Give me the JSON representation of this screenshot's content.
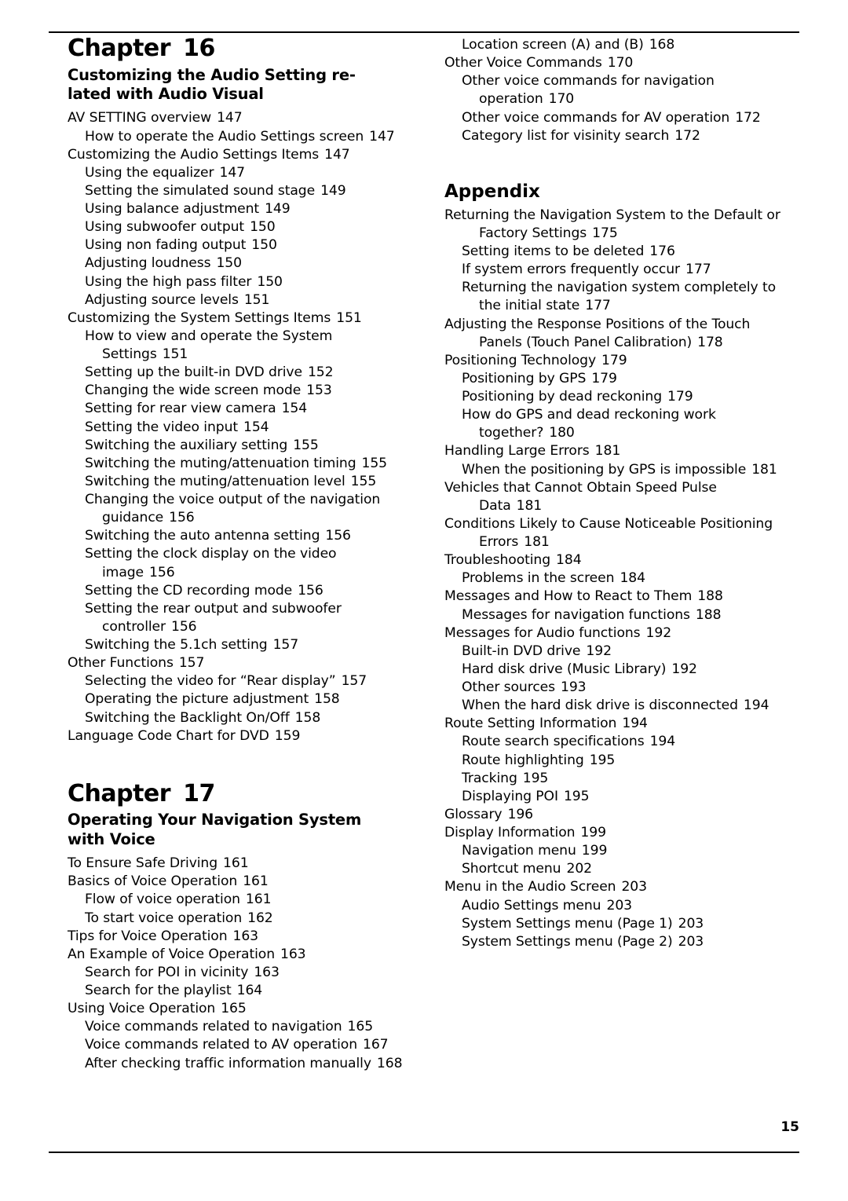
{
  "page_number": "15",
  "left_column": {
    "chapter": {
      "word": "Chapter",
      "number": "16"
    },
    "chapter_title_line1": "Customizing the Audio Setting re-",
    "chapter_title_line2": "lated with Audio Visual",
    "entries": [
      {
        "level": 0,
        "text": "AV SETTING overview",
        "page": "147"
      },
      {
        "level": 1,
        "text": "How to operate the Audio Settings screen",
        "page": "147"
      },
      {
        "level": 0,
        "text": "Customizing the Audio Settings Items",
        "page": "147"
      },
      {
        "level": 1,
        "text": "Using the equalizer",
        "page": "147"
      },
      {
        "level": 1,
        "text": "Setting the simulated sound stage",
        "page": "149"
      },
      {
        "level": 1,
        "text": "Using balance adjustment",
        "page": "149"
      },
      {
        "level": 1,
        "text": "Using subwoofer output",
        "page": "150"
      },
      {
        "level": 1,
        "text": "Using non fading output",
        "page": "150"
      },
      {
        "level": 1,
        "text": "Adjusting loudness",
        "page": "150"
      },
      {
        "level": 1,
        "text": "Using the high pass filter",
        "page": "150"
      },
      {
        "level": 1,
        "text": "Adjusting source levels",
        "page": "151"
      },
      {
        "level": 0,
        "text": "Customizing the System Settings Items",
        "page": "151"
      },
      {
        "level": 1,
        "text": "How to view and operate the System",
        "page": ""
      },
      {
        "level": 2,
        "text": "Settings",
        "page": "151"
      },
      {
        "level": 1,
        "text": "Setting up the built-in DVD drive",
        "page": "152"
      },
      {
        "level": 1,
        "text": "Changing the wide screen mode",
        "page": "153"
      },
      {
        "level": 1,
        "text": "Setting for rear view camera",
        "page": "154"
      },
      {
        "level": 1,
        "text": "Setting the video input",
        "page": "154"
      },
      {
        "level": 1,
        "text": "Switching the auxiliary setting",
        "page": "155"
      },
      {
        "level": 1,
        "text": "Switching the muting/attenuation timing",
        "page": "155"
      },
      {
        "level": 1,
        "text": "Switching the muting/attenuation level",
        "page": "155"
      },
      {
        "level": 1,
        "text": "Changing the voice output of the navigation",
        "page": ""
      },
      {
        "level": 2,
        "text": "guidance",
        "page": "156"
      },
      {
        "level": 1,
        "text": "Switching the auto antenna setting",
        "page": "156"
      },
      {
        "level": 1,
        "text": "Setting the clock display on the video",
        "page": ""
      },
      {
        "level": 2,
        "text": "image",
        "page": "156"
      },
      {
        "level": 1,
        "text": "Setting the CD recording mode",
        "page": "156"
      },
      {
        "level": 1,
        "text": "Setting the rear output and subwoofer",
        "page": ""
      },
      {
        "level": 2,
        "text": "controller",
        "page": "156"
      },
      {
        "level": 1,
        "text": "Switching the 5.1ch setting",
        "page": "157"
      },
      {
        "level": 0,
        "text": "Other Functions",
        "page": "157"
      },
      {
        "level": 1,
        "text": "Selecting the video for “Rear display”",
        "page": "157"
      },
      {
        "level": 1,
        "text": "Operating the picture adjustment",
        "page": "158"
      },
      {
        "level": 1,
        "text": "Switching the Backlight On/Off",
        "page": "158"
      },
      {
        "level": 0,
        "text": "Language Code Chart for DVD",
        "page": "159"
      }
    ],
    "chapter2": {
      "word": "Chapter",
      "number": "17"
    },
    "chapter2_title_line1": "Operating Your Navigation System",
    "chapter2_title_line2": "with Voice",
    "entries2": [
      {
        "level": 0,
        "text": "To Ensure Safe Driving",
        "page": "161"
      },
      {
        "level": 0,
        "text": "Basics of Voice Operation",
        "page": "161"
      },
      {
        "level": 1,
        "text": "Flow of voice operation",
        "page": "161"
      },
      {
        "level": 1,
        "text": "To start voice operation",
        "page": "162"
      },
      {
        "level": 0,
        "text": "Tips for Voice Operation",
        "page": "163"
      },
      {
        "level": 0,
        "text": "An Example of Voice Operation",
        "page": "163"
      },
      {
        "level": 1,
        "text": "Search for POI in vicinity",
        "page": "163"
      },
      {
        "level": 1,
        "text": "Search for the playlist",
        "page": "164"
      },
      {
        "level": 0,
        "text": "Using Voice Operation",
        "page": "165"
      },
      {
        "level": 1,
        "text": "Voice commands related to navigation",
        "page": "165"
      },
      {
        "level": 1,
        "text": "Voice commands related to AV operation",
        "page": "167"
      },
      {
        "level": 1,
        "text": "After checking traffic information manually",
        "page": "168"
      }
    ]
  },
  "right_column": {
    "entries_top": [
      {
        "level": 1,
        "text": "Location screen (A) and (B)",
        "page": "168"
      },
      {
        "level": 0,
        "text": "Other Voice Commands",
        "page": "170"
      },
      {
        "level": 1,
        "text": "Other voice commands for navigation",
        "page": ""
      },
      {
        "level": 2,
        "text": "operation",
        "page": "170"
      },
      {
        "level": 1,
        "text": "Other voice commands for AV operation",
        "page": "172"
      },
      {
        "level": 1,
        "text": "Category list for visinity search",
        "page": "172"
      }
    ],
    "appendix_head": "Appendix",
    "entries_appendix": [
      {
        "level": 0,
        "text": "Returning the Navigation System to the Default or",
        "page": ""
      },
      {
        "level": 2,
        "text": "Factory Settings",
        "page": "175"
      },
      {
        "level": 1,
        "text": "Setting items to be deleted",
        "page": "176"
      },
      {
        "level": 1,
        "text": "If system errors frequently occur",
        "page": "177"
      },
      {
        "level": 1,
        "text": "Returning the navigation system completely to",
        "page": ""
      },
      {
        "level": 2,
        "text": "the initial state",
        "page": "177"
      },
      {
        "level": 0,
        "text": "Adjusting the Response Positions of the Touch",
        "page": ""
      },
      {
        "level": 2,
        "text": "Panels (Touch Panel Calibration)",
        "page": "178"
      },
      {
        "level": 0,
        "text": "Positioning Technology",
        "page": "179"
      },
      {
        "level": 1,
        "text": "Positioning by GPS",
        "page": "179"
      },
      {
        "level": 1,
        "text": "Positioning by dead reckoning",
        "page": "179"
      },
      {
        "level": 1,
        "text": "How do GPS and dead reckoning work",
        "page": ""
      },
      {
        "level": 2,
        "text": "together?",
        "page": "180"
      },
      {
        "level": 0,
        "text": "Handling Large Errors",
        "page": "181"
      },
      {
        "level": 1,
        "text": "When the positioning by GPS is impossible",
        "page": "181"
      },
      {
        "level": 0,
        "text": "Vehicles that Cannot Obtain Speed Pulse",
        "page": ""
      },
      {
        "level": 2,
        "text": "Data",
        "page": "181"
      },
      {
        "level": 0,
        "text": "Conditions Likely to Cause Noticeable Positioning",
        "page": ""
      },
      {
        "level": 2,
        "text": "Errors",
        "page": "181"
      },
      {
        "level": 0,
        "text": "Troubleshooting",
        "page": "184"
      },
      {
        "level": 1,
        "text": "Problems in the screen",
        "page": "184"
      },
      {
        "level": 0,
        "text": "Messages and How to React to Them",
        "page": "188"
      },
      {
        "level": 1,
        "text": "Messages for navigation functions",
        "page": "188"
      },
      {
        "level": 0,
        "text": "Messages for Audio functions",
        "page": "192"
      },
      {
        "level": 1,
        "text": "Built-in DVD drive",
        "page": "192"
      },
      {
        "level": 1,
        "text": "Hard disk drive (Music Library)",
        "page": "192"
      },
      {
        "level": 1,
        "text": "Other sources",
        "page": "193"
      },
      {
        "level": 1,
        "text": "When the hard disk drive is disconnected",
        "page": "194"
      },
      {
        "level": 0,
        "text": "Route Setting Information",
        "page": "194"
      },
      {
        "level": 1,
        "text": "Route search specifications",
        "page": "194"
      },
      {
        "level": 1,
        "text": "Route highlighting",
        "page": "195"
      },
      {
        "level": 1,
        "text": "Tracking",
        "page": "195"
      },
      {
        "level": 1,
        "text": "Displaying POI",
        "page": "195"
      },
      {
        "level": 0,
        "text": "Glossary",
        "page": "196"
      },
      {
        "level": 0,
        "text": "Display Information",
        "page": "199"
      },
      {
        "level": 1,
        "text": "Navigation menu",
        "page": "199"
      },
      {
        "level": 1,
        "text": "Shortcut menu",
        "page": "202"
      },
      {
        "level": 0,
        "text": "Menu in the Audio Screen",
        "page": "203"
      },
      {
        "level": 1,
        "text": "Audio Settings menu",
        "page": "203"
      },
      {
        "level": 1,
        "text": "System Settings menu (Page 1)",
        "page": "203"
      },
      {
        "level": 1,
        "text": "System Settings menu (Page 2)",
        "page": "203"
      }
    ]
  }
}
